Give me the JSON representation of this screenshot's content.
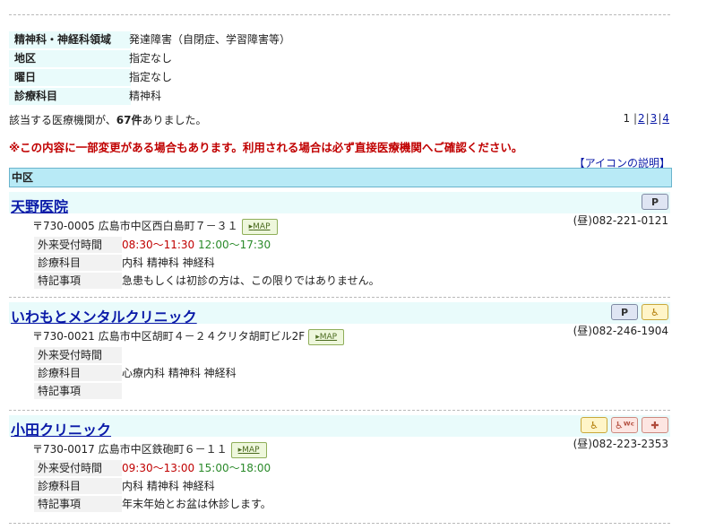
{
  "conditions": [
    {
      "key": "精神科・神経科領域",
      "value": "発達障害（自閉症、学習障害等）"
    },
    {
      "key": "地区",
      "value": "指定なし"
    },
    {
      "key": "曜日",
      "value": "指定なし"
    },
    {
      "key": "診療科目",
      "value": "精神科"
    }
  ],
  "result": {
    "prefix": "該当する医療機関が、",
    "count": "67件",
    "suffix": "ありました。"
  },
  "pager": {
    "current": "1",
    "pages": [
      "2",
      "3",
      "4"
    ],
    "sep": "|"
  },
  "warning": "※この内容に一部変更がある場合もあります。利用される場合は必ず直接医療機関へご確認ください。",
  "icon_help": "【アイコンの説明】",
  "region": "中区",
  "labels": {
    "hours": "外来受付時間",
    "dept": "診療科目",
    "notes": "特記事項",
    "map": "MAP"
  },
  "clinics": [
    {
      "name": "天野医院",
      "icons": [
        "parking-icon"
      ],
      "address": "〒730-0005 広島市中区西白島町７－３１",
      "tel": "(昼)082-221-0121",
      "hours_am": "08:30～11:30",
      "hours_pm": "12:00～17:30",
      "dept": "内科 精神科 神経科",
      "notes": "急患もしくは初診の方は、この限りではありません。"
    },
    {
      "name": "いわもとメンタルクリニック",
      "icons": [
        "parking-icon",
        "wheelchair-icon"
      ],
      "address": "〒730-0021 広島市中区胡町４－２４クリタ胡町ビル2F",
      "tel": "(昼)082-246-1904",
      "hours_am": "",
      "hours_pm": "",
      "dept": "心療内科 精神科 神経科",
      "notes": ""
    },
    {
      "name": "小田クリニック",
      "icons": [
        "wheelchair-icon",
        "wheelchair-toilet-icon",
        "ostomate-icon"
      ],
      "address": "〒730-0017 広島市中区鉄砲町６－１１",
      "tel": "(昼)082-223-2353",
      "hours_am": "09:30～13:00",
      "hours_pm": "15:00～18:00",
      "dept": "内科 精神科 神経科",
      "notes": "年末年始とお盆は休診します。"
    }
  ]
}
